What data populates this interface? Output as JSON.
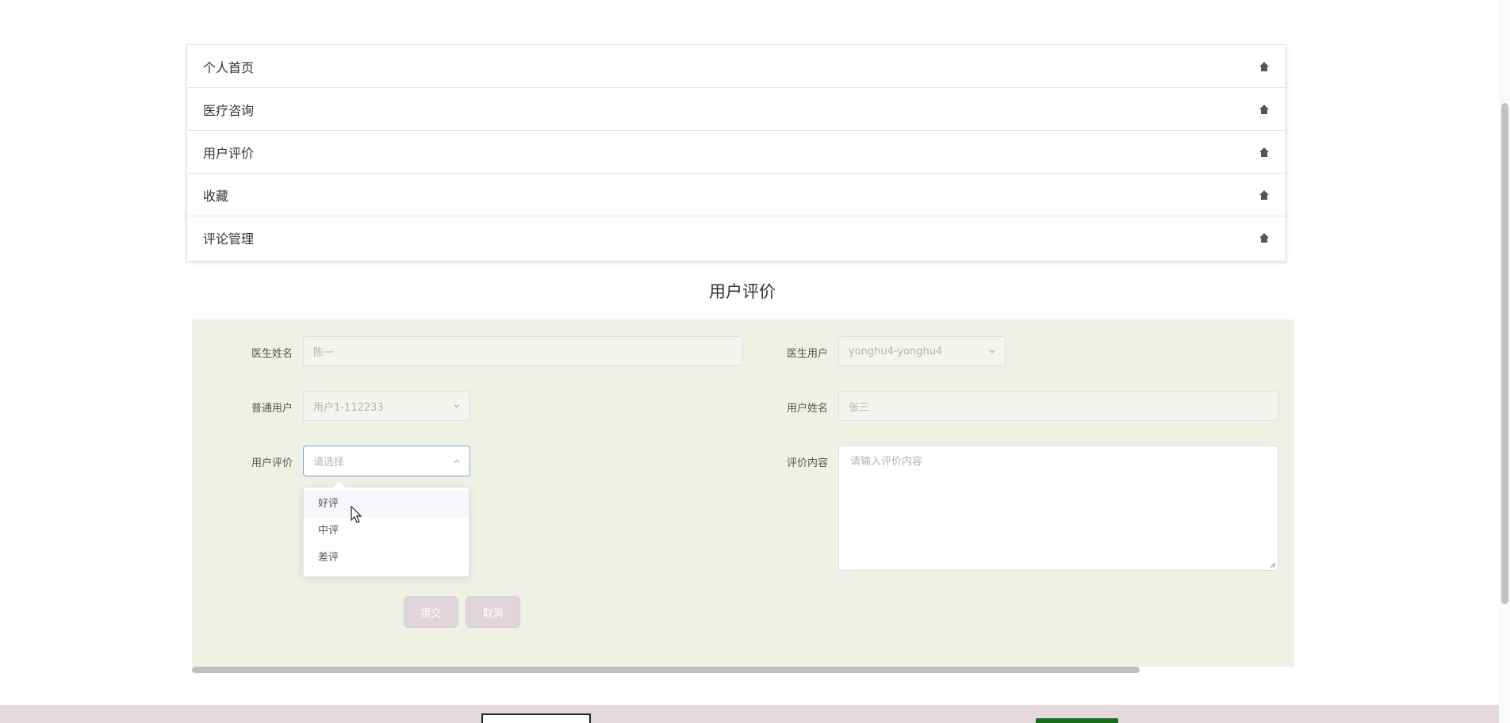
{
  "menu": {
    "items": [
      {
        "label": "个人首页",
        "icon": "home-icon"
      },
      {
        "label": "医疗咨询",
        "icon": "home-icon"
      },
      {
        "label": "用户评价",
        "icon": "home-icon"
      },
      {
        "label": "收藏",
        "icon": "home-icon"
      },
      {
        "label": "评论管理",
        "icon": "home-icon"
      }
    ]
  },
  "page": {
    "title": "用户评价"
  },
  "form": {
    "doctor_name": {
      "label": "医生姓名",
      "value": "陈一"
    },
    "doctor_user": {
      "label": "医生用户",
      "value": "yonghu4-yonghu4"
    },
    "normal_user": {
      "label": "普通用户",
      "value": "用户1-112233"
    },
    "user_name": {
      "label": "用户姓名",
      "value": "张三"
    },
    "rating": {
      "label": "用户评价",
      "placeholder": "请选择",
      "options": [
        "好评",
        "中评",
        "差评"
      ],
      "hovered": "好评"
    },
    "content": {
      "label": "评价内容",
      "placeholder": "请输入评价内容"
    },
    "submit_label": "提交",
    "cancel_label": "取消"
  },
  "colors": {
    "panel_bg": "#eef1e4",
    "button_bg": "#dfd5da",
    "footer_bg": "#e5d9de",
    "focus_border": "#7aa8d8"
  }
}
